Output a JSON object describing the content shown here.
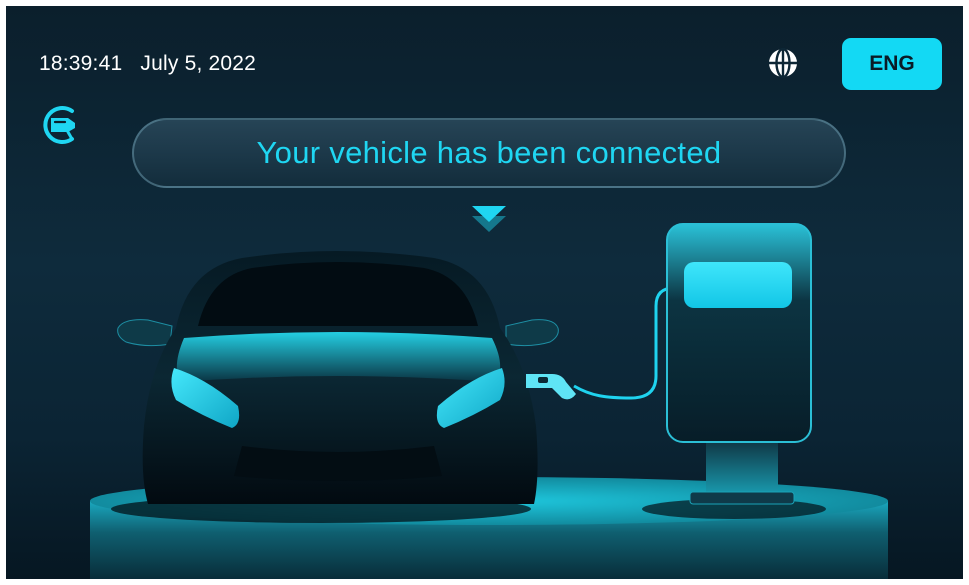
{
  "status_bar": {
    "time": "18:39:41",
    "date": "July 5, 2022",
    "language_label": "ENG",
    "language_icon": "globe-icon"
  },
  "connection": {
    "status_icon": "plug-connected-icon",
    "message": "Your vehicle has been connected"
  },
  "illustration": {
    "items": [
      "car-front",
      "charging-cable",
      "charging-station",
      "platform"
    ]
  },
  "colors": {
    "accent": "#13d9f4",
    "background_top": "#0b1f2c",
    "background_bottom": "#061722",
    "text_primary": "#ffffff"
  }
}
